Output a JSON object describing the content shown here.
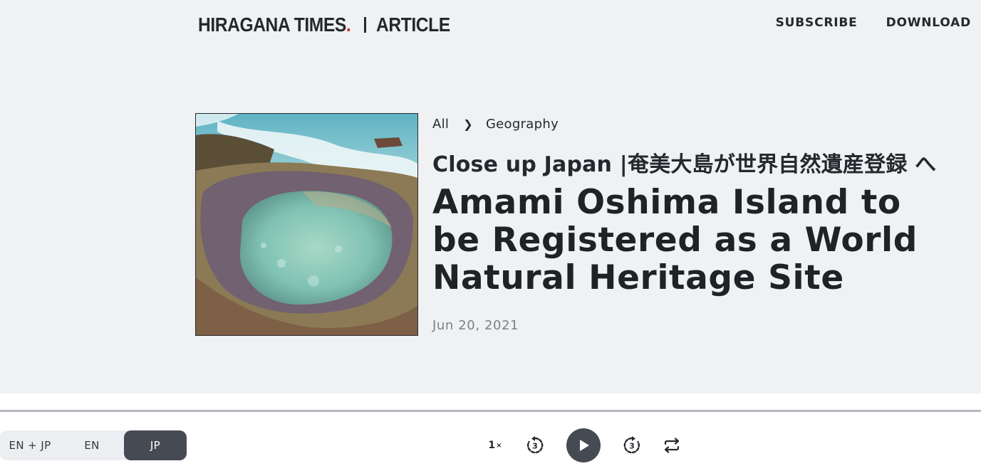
{
  "header": {
    "brand_name": "HIRAGANA TIMES",
    "brand_dot": ".",
    "section": "ARTICLE",
    "nav": [
      "SUBSCRIBE",
      "DOWNLOAD"
    ]
  },
  "article": {
    "breadcrumb": [
      "All",
      "Geography"
    ],
    "series_title": "Close up Japan |奄美大島が世界自然遺産登録 へ",
    "title": "Amami Oshima Island to be Registered as a World Natural Heritage Site",
    "date": "Jun 20, 2021",
    "image_icon": "photo-tide-pool"
  },
  "player": {
    "languages": [
      "EN + JP",
      "EN",
      "JP"
    ],
    "selected_language": "JP",
    "speed": "1",
    "speed_suffix": "×",
    "rewind_seconds": "3",
    "forward_seconds": "3",
    "icons": [
      "speed-icon",
      "rewind-3-icon",
      "play-icon",
      "forward-3-icon",
      "loop-icon"
    ]
  },
  "colors": {
    "background_top": "#f0f1f3",
    "text": "#25282e",
    "brand_dot": "#c3361f",
    "date": "#7c8086",
    "control_dark": "#454a53"
  }
}
